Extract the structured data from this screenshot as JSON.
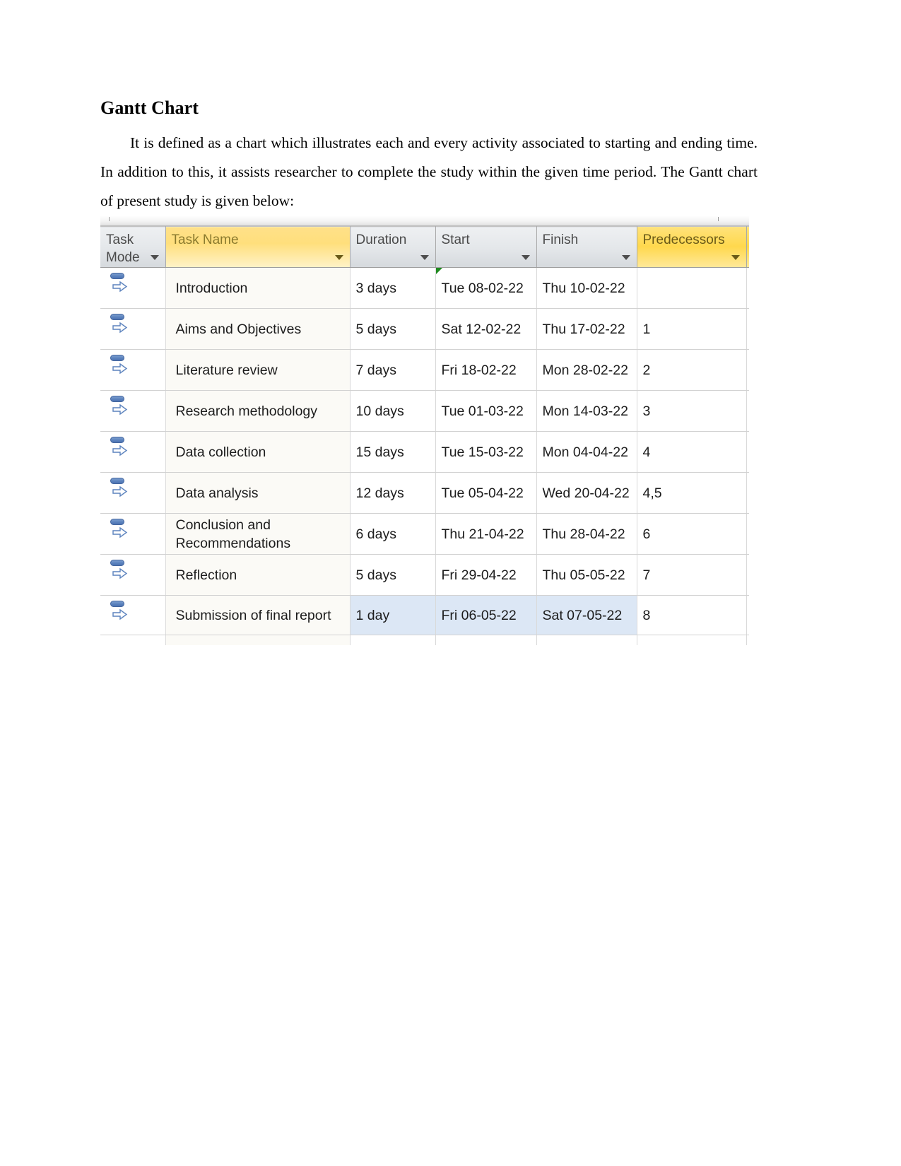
{
  "document": {
    "heading": "Gantt Chart",
    "paragraph": "It is defined as a chart which illustrates each and every activity associated to starting and ending time. In addition to this, it assists researcher to complete the study within the given time period.  The Gantt chart of present study is given below:"
  },
  "grid": {
    "columns": [
      {
        "key": "task_mode",
        "label": "Task Mode",
        "highlight": false,
        "has_filter": true
      },
      {
        "key": "task_name",
        "label": "Task Name",
        "highlight": true,
        "has_filter": true
      },
      {
        "key": "duration",
        "label": "Duration",
        "highlight": false,
        "has_filter": true
      },
      {
        "key": "start",
        "label": "Start",
        "highlight": false,
        "has_filter": true
      },
      {
        "key": "finish",
        "label": "Finish",
        "highlight": false,
        "has_filter": true
      },
      {
        "key": "predecessors",
        "label": "Predecessors",
        "highlight": true,
        "has_filter": true
      }
    ],
    "icons": {
      "task_mode": "manually-scheduled-task-icon",
      "filter": "chevron-down-icon",
      "indicator": "green-corner-indicator"
    },
    "colors": {
      "header_accent": "#ffd84d",
      "header_plain": "#e4e7ea",
      "selection": "#dce7f5",
      "task_name_cell": "#fbfaf6",
      "indicator_green": "#1f8a1f",
      "icon_blue": "#5b82bd"
    },
    "rows": [
      {
        "id": "1",
        "task_name": "Introduction",
        "duration": "3 days",
        "start": "Tue 08-02-22",
        "finish": "Thu 10-02-22",
        "predecessors": "",
        "indicator": true,
        "selected": false
      },
      {
        "id": "2",
        "task_name": "Aims and Objectives",
        "duration": "5 days",
        "start": "Sat 12-02-22",
        "finish": "Thu 17-02-22",
        "predecessors": "1",
        "indicator": false,
        "selected": false
      },
      {
        "id": "3",
        "task_name": "Literature review",
        "duration": "7 days",
        "start": "Fri 18-02-22",
        "finish": "Mon 28-02-22",
        "predecessors": "2",
        "indicator": false,
        "selected": false
      },
      {
        "id": "4",
        "task_name": "Research methodology",
        "duration": "10 days",
        "start": "Tue 01-03-22",
        "finish": "Mon 14-03-22",
        "predecessors": "3",
        "indicator": false,
        "selected": false
      },
      {
        "id": "5",
        "task_name": "Data collection",
        "duration": "15 days",
        "start": "Tue 15-03-22",
        "finish": "Mon 04-04-22",
        "predecessors": "4",
        "indicator": false,
        "selected": false
      },
      {
        "id": "6",
        "task_name": "Data analysis",
        "duration": "12 days",
        "start": "Tue 05-04-22",
        "finish": "Wed 20-04-22",
        "predecessors": "4,5",
        "indicator": false,
        "selected": false
      },
      {
        "id": "7",
        "task_name": "Conclusion and Recommendations",
        "duration": "6 days",
        "start": "Thu 21-04-22",
        "finish": "Thu 28-04-22",
        "predecessors": "6",
        "indicator": false,
        "selected": false
      },
      {
        "id": "8",
        "task_name": "Reflection",
        "duration": "5 days",
        "start": "Fri 29-04-22",
        "finish": "Thu 05-05-22",
        "predecessors": "7",
        "indicator": false,
        "selected": false
      },
      {
        "id": "9",
        "task_name": "Submission of final report",
        "duration": "1 day",
        "start": "Fri 06-05-22",
        "finish": "Sat 07-05-22",
        "predecessors": "8",
        "indicator": false,
        "selected": true
      }
    ]
  }
}
